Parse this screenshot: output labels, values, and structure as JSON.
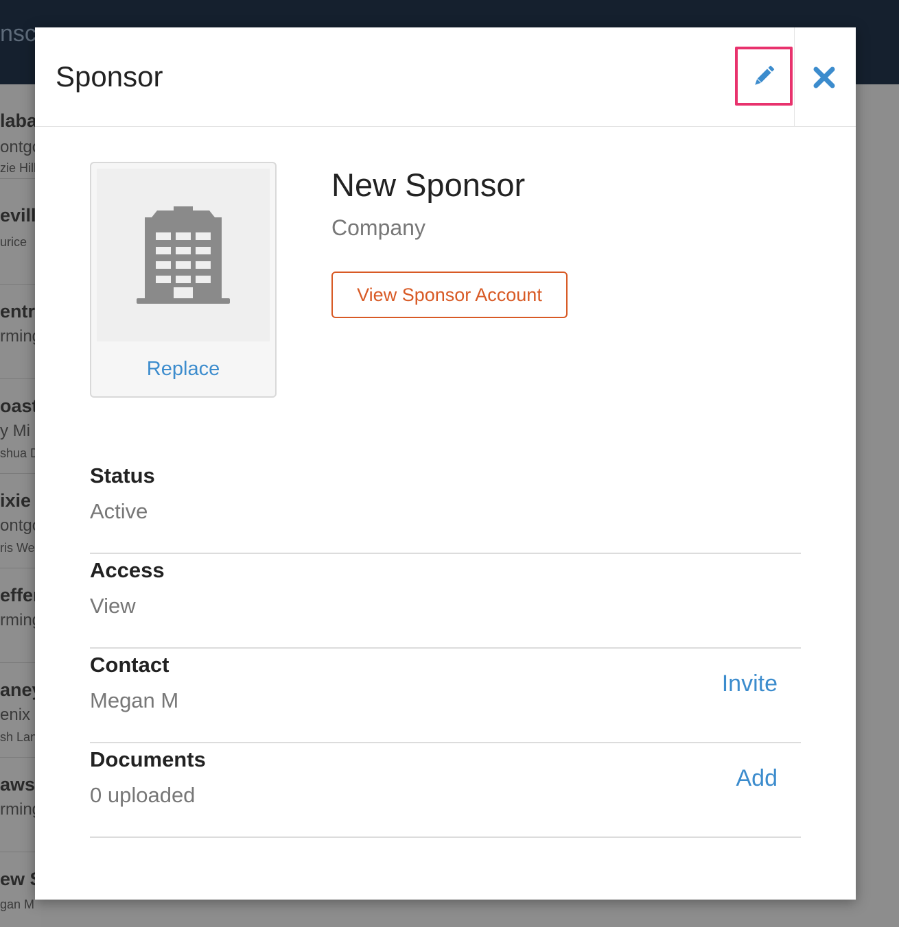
{
  "background": {
    "app_title_fragment": "nsc",
    "list_items": [
      {
        "title": "laba",
        "line2": "ontgo",
        "line3": "zie Hill"
      },
      {
        "title": "evill",
        "line2": "urice",
        "line3": ""
      },
      {
        "title": "entr",
        "line2": "rming",
        "line3": ""
      },
      {
        "title": "oast",
        "line2": "y Mi",
        "line3": "shua D"
      },
      {
        "title": "ixie",
        "line2": "ontgo",
        "line3": "ris We"
      },
      {
        "title": "effer",
        "line2": "rming",
        "line3": ""
      },
      {
        "title": "aney",
        "line2": "enix",
        "line3": "sh Lan"
      },
      {
        "title": "awso",
        "line2": "rming",
        "line3": ""
      },
      {
        "title": "ew S",
        "line2": "gan M",
        "line3": ""
      }
    ]
  },
  "modal": {
    "title": "Sponsor",
    "edit_icon": "pencil-icon",
    "close_icon": "close-icon",
    "logo_icon": "building-icon",
    "replace_label": "Replace",
    "sponsor_name": "New Sponsor",
    "sponsor_type": "Company",
    "view_account_label": "View Sponsor Account",
    "details": [
      {
        "label": "Status",
        "value": "Active",
        "action": ""
      },
      {
        "label": "Access",
        "value": "View",
        "action": ""
      },
      {
        "label": "Contact",
        "value": "Megan M",
        "action": "Invite"
      },
      {
        "label": "Documents",
        "value": "0 uploaded",
        "action": "Add"
      }
    ]
  },
  "colors": {
    "accent_blue": "#3c8ccd",
    "accent_orange": "#d85a25",
    "highlight_pink": "#e8326d",
    "topbar_navy": "#15202e"
  }
}
